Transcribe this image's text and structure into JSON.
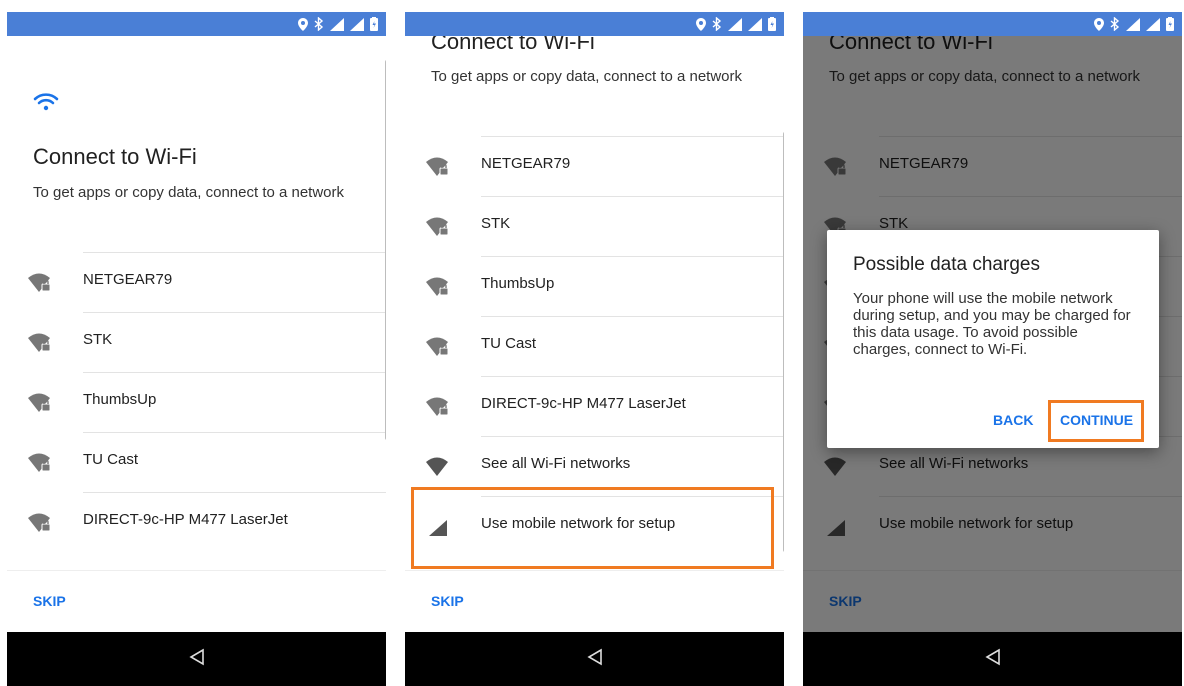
{
  "header": {
    "title": "Connect to Wi-Fi",
    "subtitle": "To get apps or copy data, connect to a network"
  },
  "networks": [
    {
      "name": "NETGEAR79",
      "icon": "wifi-lock-icon"
    },
    {
      "name": "STK",
      "icon": "wifi-lock-icon"
    },
    {
      "name": "ThumbsUp",
      "icon": "wifi-lock-icon"
    },
    {
      "name": "TU Cast",
      "icon": "wifi-lock-icon"
    },
    {
      "name": "DIRECT-9c-HP M477 LaserJet",
      "icon": "wifi-lock-icon"
    }
  ],
  "options": {
    "see_all": "See all Wi-Fi networks",
    "use_mobile": "Use mobile network for setup"
  },
  "footer": {
    "skip_label": "SKIP"
  },
  "dialog": {
    "title": "Possible data charges",
    "body": "Your phone will use the mobile network during setup, and you may be charged for this data usage. To avoid possible charges, connect to Wi-Fi.",
    "back_label": "BACK",
    "continue_label": "CONTINUE"
  },
  "colors": {
    "status_bar": "#4a7fd6",
    "accent": "#1a73e8",
    "highlight": "#f07a21"
  }
}
